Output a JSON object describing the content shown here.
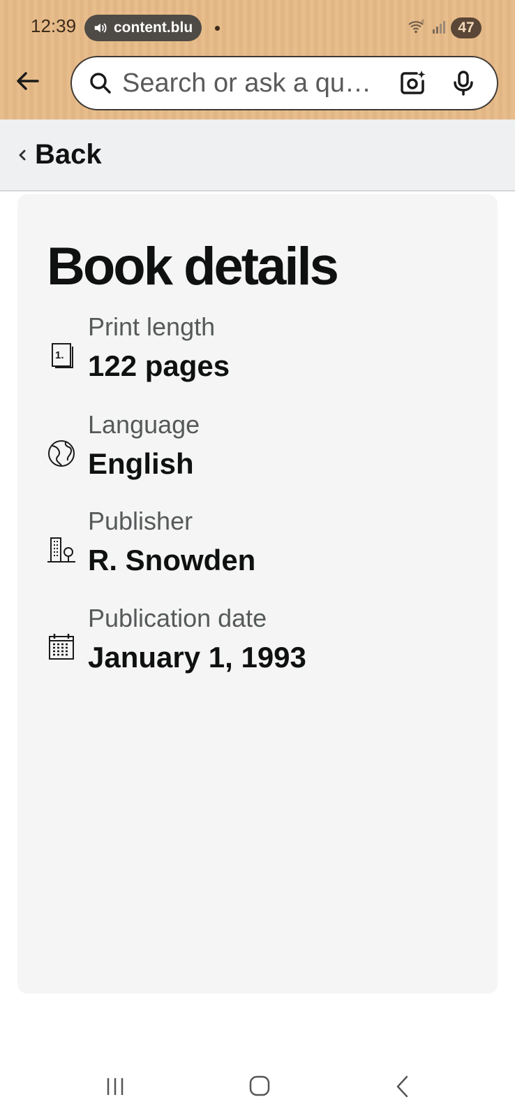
{
  "status_bar": {
    "time": "12:39",
    "media_source": "content.blu",
    "battery": "47"
  },
  "browser": {
    "search_placeholder": "Search or ask a qu…"
  },
  "nav": {
    "back_label": "Back"
  },
  "book_details": {
    "title": "Book details",
    "items": [
      {
        "label": "Print length",
        "value": "122 pages",
        "icon": "page-number-icon"
      },
      {
        "label": "Language",
        "value": "English",
        "icon": "globe-icon"
      },
      {
        "label": "Publisher",
        "value": "R. Snowden",
        "icon": "building-icon"
      },
      {
        "label": "Publication date",
        "value": "January 1, 1993",
        "icon": "calendar-icon"
      }
    ]
  },
  "colors": {
    "chrome_background": "#e7bd8c",
    "card_background": "#f5f5f5",
    "back_row_background": "#eef0f1",
    "text_primary": "#0f1111",
    "text_secondary": "#565959"
  }
}
